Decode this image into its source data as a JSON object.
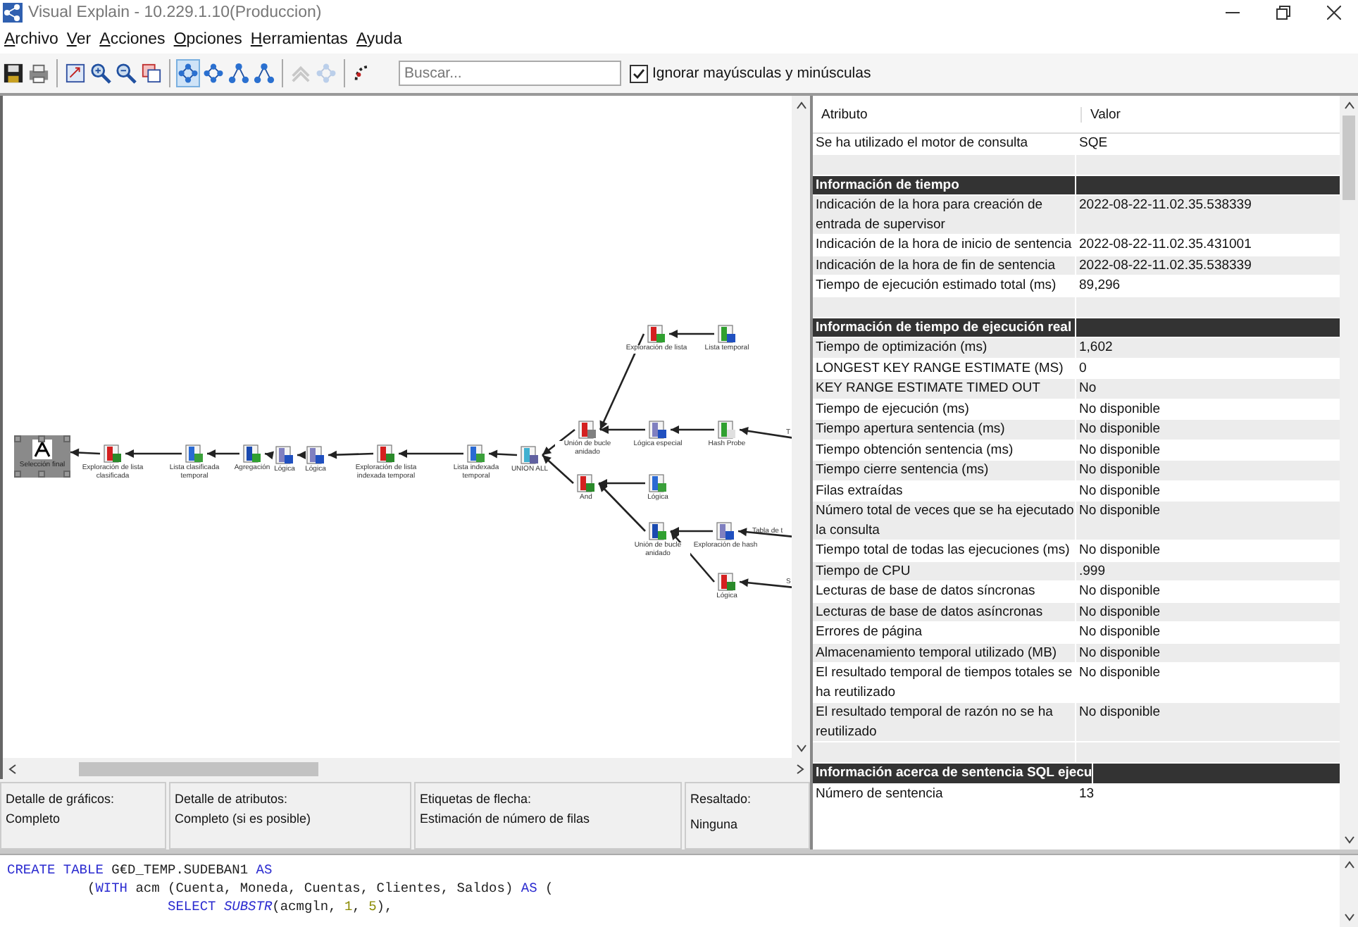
{
  "window": {
    "title": "Visual Explain - 10.229.1.10(Produccion)"
  },
  "menu": [
    "Archivo",
    "Ver",
    "Acciones",
    "Opciones",
    "Herramientas",
    "Ayuda"
  ],
  "toolbar": {
    "buttons": [
      {
        "selected": false,
        "disabled": false
      },
      {
        "selected": false,
        "disabled": false
      },
      {
        "selected": false,
        "disabled": false
      },
      {
        "selected": false,
        "disabled": false
      },
      {
        "selected": false,
        "disabled": false
      },
      {
        "selected": false,
        "disabled": false
      },
      {
        "selected": true,
        "disabled": false
      },
      {
        "selected": false,
        "disabled": false
      },
      {
        "selected": false,
        "disabled": false
      },
      {
        "selected": false,
        "disabled": false
      },
      {
        "selected": false,
        "disabled": true
      },
      {
        "selected": false,
        "disabled": true
      },
      {
        "selected": false,
        "disabled": false
      }
    ],
    "search": {
      "placeholder": "Buscar..."
    },
    "ignore_case": {
      "label": "Ignorar mayúsculas y minúsculas",
      "checked": true
    }
  },
  "diagram": {
    "root": {
      "label": "Selección final",
      "kind": "node",
      "selected": true,
      "children": [
        {
          "label": "Exploración de lista clasificada",
          "kind": "node",
          "selected": false,
          "children": [
            {
              "label": "Lista clasificada temporal",
              "kind": "node",
              "selected": false,
              "children": [
                {
                  "label": "Agregación",
                  "kind": "node",
                  "selected": false,
                  "children": [
                    {
                      "label": "Lógica",
                      "kind": "node",
                      "selected": false,
                      "children": [
                        {
                          "label": "Lógica",
                          "kind": "node",
                          "selected": false,
                          "children": [
                            {
                              "label": "Exploración de lista indexada temporal",
                              "kind": "node",
                              "selected": false,
                              "children": [
                                {
                                  "label": "Lista indexada temporal",
                                  "kind": "node",
                                  "selected": false,
                                  "children": [
                                    {
                                      "label": "UNION ALL",
                                      "kind": "node",
                                      "selected": false,
                                      "children": [
                                        {
                                          "label": "Unión de bucle anidado",
                                          "kind": "node",
                                          "selected": false,
                                          "children": [
                                            {
                                              "label": "Exploración de lista",
                                              "kind": "node",
                                              "selected": false,
                                              "children": [
                                                {
                                                  "label": "Lista temporal",
                                                  "kind": "node",
                                                  "selected": false
                                                }
                                              ]
                                            },
                                            {
                                              "label": "Lógica especial",
                                              "kind": "node",
                                              "selected": false,
                                              "children": [
                                                {
                                                  "label": "Hash Probe",
                                                  "kind": "node",
                                                  "selected": false,
                                                  "children": [
                                                    {
                                                      "label": "T",
                                                      "kind": "clipped"
                                                    }
                                                  ]
                                                }
                                              ]
                                            }
                                          ]
                                        },
                                        {
                                          "label": "And",
                                          "kind": "node",
                                          "selected": false,
                                          "children": [
                                            {
                                              "label": "Lógica",
                                              "kind": "node",
                                              "selected": false
                                            },
                                            {
                                              "label": "Unión de bucle anidado",
                                              "kind": "node",
                                              "selected": false,
                                              "children": [
                                                {
                                                  "label": "Exploración de hash",
                                                  "kind": "node",
                                                  "selected": false,
                                                  "children": [
                                                    {
                                                      "label": "Tabla de t",
                                                      "kind": "clipped"
                                                    }
                                                  ]
                                                },
                                                {
                                                  "label": "Lógica",
                                                  "kind": "node",
                                                  "selected": false,
                                                  "children": [
                                                    {
                                                      "label": "S",
                                                      "kind": "clipped"
                                                    }
                                                  ]
                                                }
                                              ]
                                            }
                                          ]
                                        }
                                      ]
                                    }
                                  ]
                                }
                              ]
                            }
                          ]
                        }
                      ]
                    }
                  ]
                }
              ]
            }
          ]
        }
      ]
    }
  },
  "status_bar": [
    {
      "label": "Detalle de gráficos:",
      "value": "Completo"
    },
    {
      "label": "Detalle de atributos:",
      "value": "Completo (si es posible)"
    },
    {
      "label": "Etiquetas de flecha:",
      "value": "Estimación de número de filas"
    },
    {
      "label": "Resaltado:",
      "value": "Ninguna"
    }
  ],
  "properties": {
    "columns": [
      "Atributo",
      "Valor"
    ],
    "rows": [
      {
        "kind": "row",
        "attribute": "Se ha utilizado el motor de consulta",
        "value": "SQE"
      },
      {
        "kind": "blank"
      },
      {
        "kind": "section",
        "attribute": "Información de tiempo"
      },
      {
        "kind": "row",
        "attribute": "Indicación de la hora para creación de entrada de supervisor",
        "value": "2022-08-22-11.02.35.538339"
      },
      {
        "kind": "row",
        "attribute": "Indicación de la hora de inicio de sentencia",
        "value": "2022-08-22-11.02.35.431001"
      },
      {
        "kind": "row",
        "attribute": "Indicación de la hora de fin de sentencia",
        "value": "2022-08-22-11.02.35.538339"
      },
      {
        "kind": "row",
        "attribute": "Tiempo de ejecución estimado total (ms)",
        "value": "89,296"
      },
      {
        "kind": "blank"
      },
      {
        "kind": "section",
        "attribute": "Información de tiempo de ejecución real"
      },
      {
        "kind": "row",
        "attribute": "Tiempo de optimización (ms)",
        "value": "1,602"
      },
      {
        "kind": "row",
        "attribute": "LONGEST KEY RANGE ESTIMATE (MS)",
        "value": "0"
      },
      {
        "kind": "row",
        "attribute": "KEY RANGE ESTIMATE TIMED OUT",
        "value": "No"
      },
      {
        "kind": "row",
        "attribute": "Tiempo de ejecución (ms)",
        "value": "No disponible"
      },
      {
        "kind": "row",
        "attribute": "Tiempo apertura sentencia (ms)",
        "value": "No disponible"
      },
      {
        "kind": "row",
        "attribute": "Tiempo obtención sentencia (ms)",
        "value": "No disponible"
      },
      {
        "kind": "row",
        "attribute": "Tiempo cierre sentencia (ms)",
        "value": "No disponible"
      },
      {
        "kind": "row",
        "attribute": "Filas extraídas",
        "value": "No disponible"
      },
      {
        "kind": "row",
        "attribute": "Número total de veces que se ha ejecutado la consulta",
        "value": "No disponible"
      },
      {
        "kind": "row",
        "attribute": "Tiempo total de todas las ejecuciones (ms)",
        "value": "No disponible"
      },
      {
        "kind": "row",
        "attribute": "Tiempo de CPU",
        "value": ".999"
      },
      {
        "kind": "row",
        "attribute": "Lecturas de base de datos síncronas",
        "value": "No disponible"
      },
      {
        "kind": "row",
        "attribute": "Lecturas de base de datos asíncronas",
        "value": "No disponible"
      },
      {
        "kind": "row",
        "attribute": "Errores de página",
        "value": "No disponible"
      },
      {
        "kind": "row",
        "attribute": "Almacenamiento temporal utilizado (MB)",
        "value": "No disponible"
      },
      {
        "kind": "row",
        "attribute": "El resultado temporal de tiempos totales se ha reutilizado",
        "value": "No disponible"
      },
      {
        "kind": "row",
        "attribute": "El resultado temporal de razón no se ha reutilizado",
        "value": "No disponible"
      },
      {
        "kind": "blank"
      },
      {
        "kind": "section",
        "attribute": "Información acerca de sentencia SQL ejecu"
      },
      {
        "kind": "row",
        "attribute": "Número de sentencia",
        "value": "13"
      }
    ]
  },
  "sql_editor": {
    "lines": [
      [
        {
          "kind": "keyword",
          "text": "CREATE TABLE"
        },
        {
          "kind": "plain",
          "text": " G€D_TEMP.SUDEBAN1 "
        },
        {
          "kind": "keyword",
          "text": "AS"
        }
      ],
      [
        {
          "kind": "plain",
          "text": "("
        },
        {
          "kind": "keyword",
          "text": "WITH"
        },
        {
          "kind": "plain",
          "text": " acm (Cuenta, Moneda, Cuentas, Clientes, Saldos) "
        },
        {
          "kind": "keyword",
          "text": "AS"
        },
        {
          "kind": "plain",
          "text": " ("
        }
      ],
      [
        {
          "kind": "keyword",
          "text": "SELECT "
        },
        {
          "kind": "function",
          "text": "SUBSTR"
        },
        {
          "kind": "plain",
          "text": "(acmgln, "
        },
        {
          "kind": "number",
          "text": "1"
        },
        {
          "kind": "plain",
          "text": ", "
        },
        {
          "kind": "number",
          "text": "5"
        },
        {
          "kind": "plain",
          "text": "),"
        }
      ]
    ]
  }
}
